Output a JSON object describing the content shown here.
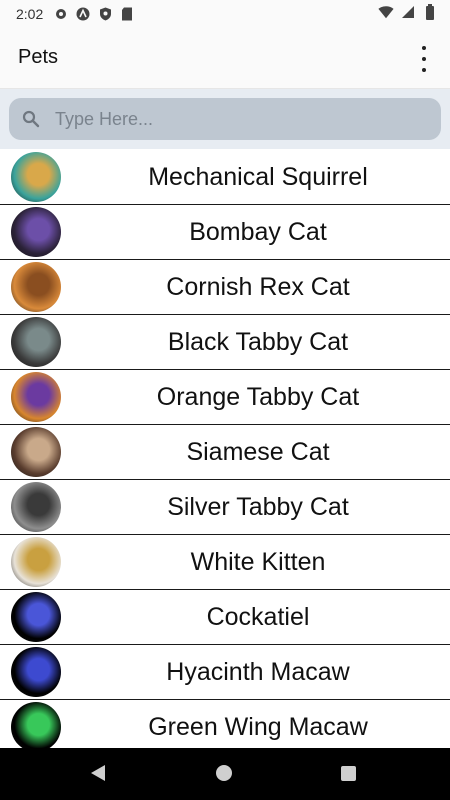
{
  "status_bar": {
    "time": "2:02"
  },
  "app_bar": {
    "title": "Pets"
  },
  "search": {
    "placeholder": "Type Here..."
  },
  "pets": [
    {
      "name": "Mechanical Squirrel",
      "c1": "#3aa39c",
      "c2": "#d9a84a"
    },
    {
      "name": "Bombay Cat",
      "c1": "#2b2238",
      "c2": "#6c4fa8"
    },
    {
      "name": "Cornish Rex Cat",
      "c1": "#d98a3a",
      "c2": "#8a4e20"
    },
    {
      "name": "Black Tabby Cat",
      "c1": "#3b3b3b",
      "c2": "#7a8a8a"
    },
    {
      "name": "Orange Tabby Cat",
      "c1": "#d8862e",
      "c2": "#6b3aa0"
    },
    {
      "name": "Siamese Cat",
      "c1": "#5a3d2e",
      "c2": "#c9a98a"
    },
    {
      "name": "Silver Tabby Cat",
      "c1": "#8e8e8e",
      "c2": "#3a3a3a"
    },
    {
      "name": "White Kitten",
      "c1": "#e8e2d8",
      "c2": "#c9a040"
    },
    {
      "name": "Cockatiel",
      "c1": "#000000",
      "c2": "#4a56d8"
    },
    {
      "name": "Hyacinth Macaw",
      "c1": "#000000",
      "c2": "#3d4ad0"
    },
    {
      "name": "Green Wing Macaw",
      "c1": "#000000",
      "c2": "#38c85a"
    }
  ]
}
